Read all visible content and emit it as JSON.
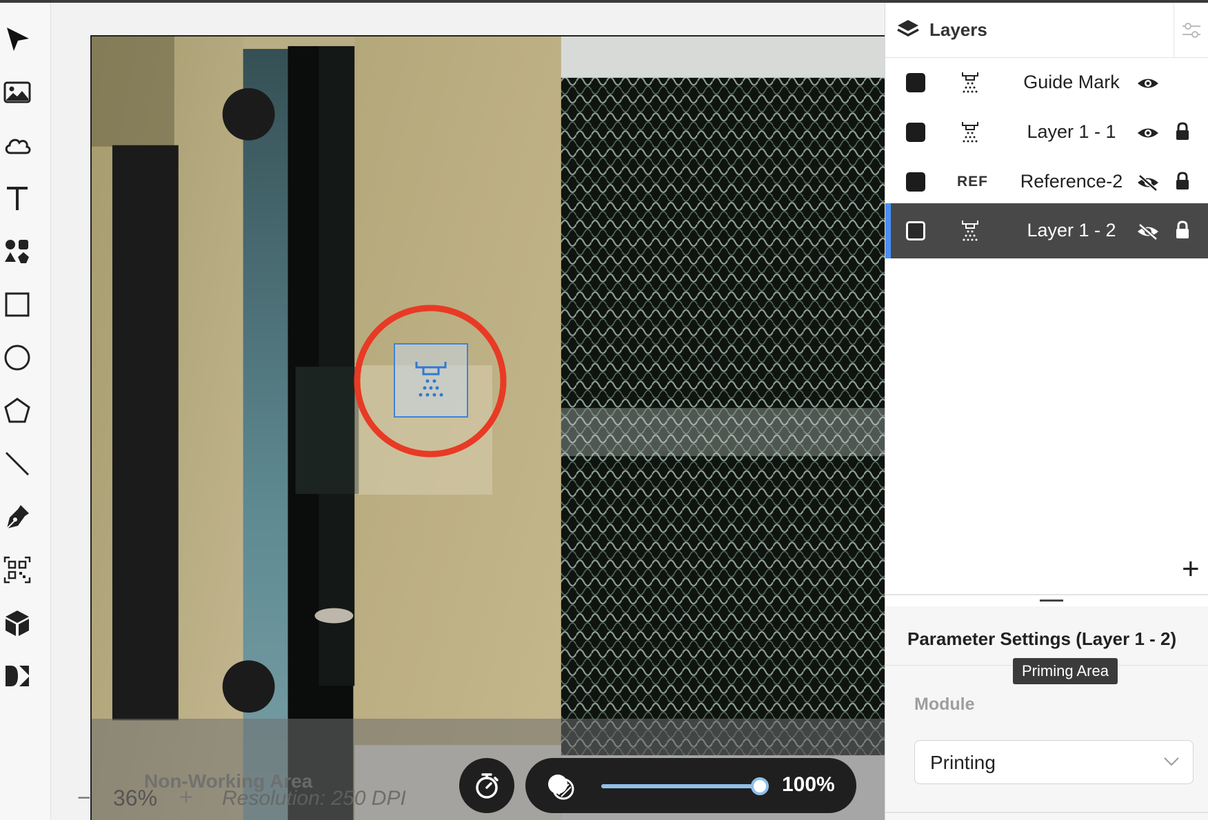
{
  "toolbar": {
    "tools": [
      {
        "name": "select-tool",
        "icon": "cursor-arrow-icon"
      },
      {
        "name": "image-tool",
        "icon": "image-icon"
      },
      {
        "name": "cloud-tool",
        "icon": "cloud-icon"
      },
      {
        "name": "text-tool",
        "icon": "text-t-icon"
      },
      {
        "name": "elements-tool",
        "icon": "shapes-icon"
      },
      {
        "name": "rectangle-tool",
        "icon": "rectangle-icon"
      },
      {
        "name": "ellipse-tool",
        "icon": "circle-icon"
      },
      {
        "name": "polygon-tool",
        "icon": "pentagon-icon"
      },
      {
        "name": "line-tool",
        "icon": "line-icon"
      },
      {
        "name": "pen-tool",
        "icon": "pen-nib-icon"
      },
      {
        "name": "qrcode-tool",
        "icon": "qr-code-icon"
      },
      {
        "name": "box-tool",
        "icon": "cube-icon"
      },
      {
        "name": "dmkt-tool",
        "icon": "dmkt-icon"
      }
    ]
  },
  "canvas": {
    "zoom_minus": "−",
    "zoom_value": "36%",
    "zoom_plus": "+",
    "non_working_area": "Non-Working Area",
    "resolution": "Resolution: 250 DPI",
    "opacity_value": "100%",
    "opacity_level": 1.0
  },
  "layers_panel": {
    "title": "Layers",
    "layers": [
      {
        "name": "Guide Mark",
        "module_icon": "printing-module-icon",
        "ref": "",
        "visible": true,
        "locked": false,
        "selected": false
      },
      {
        "name": "Layer 1 - 1",
        "module_icon": "printing-module-icon",
        "ref": "",
        "visible": true,
        "locked": true,
        "selected": false
      },
      {
        "name": "Reference-2",
        "module_icon": "",
        "ref": "REF",
        "visible": false,
        "locked": true,
        "selected": false
      },
      {
        "name": "Layer 1 - 2",
        "module_icon": "printing-module-icon",
        "ref": "",
        "visible": false,
        "locked": true,
        "selected": true
      }
    ],
    "add_label": "+"
  },
  "parameters": {
    "title": "Parameter Settings (Layer 1 - 2)",
    "tooltip": "Priming Area",
    "module_label": "Module",
    "module_value": "Printing"
  },
  "colors": {
    "accent_blue": "#4a8ef7",
    "slider": "#8fbfea",
    "selection_red": "#e83a25",
    "selected_row": "#484848"
  }
}
